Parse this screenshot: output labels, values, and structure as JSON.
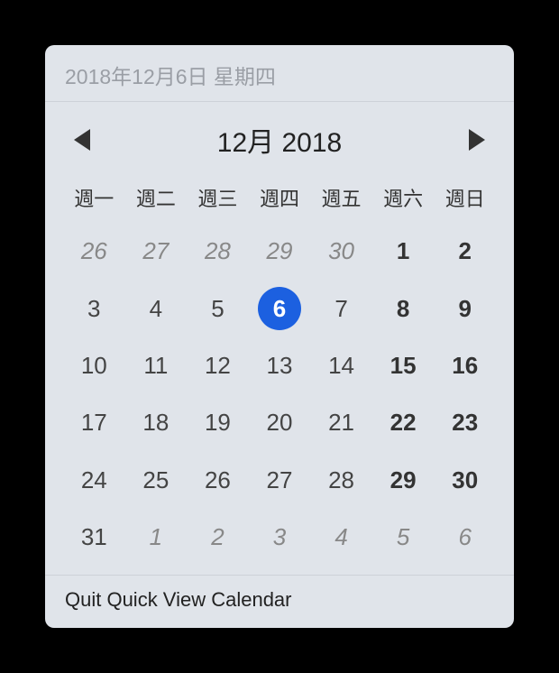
{
  "header": {
    "date_text": "2018年12月6日 星期四"
  },
  "nav": {
    "title": "12月 2018"
  },
  "days_of_week": [
    "週一",
    "週二",
    "週三",
    "週四",
    "週五",
    "週六",
    "週日"
  ],
  "weeks": [
    [
      {
        "n": "26",
        "other": true
      },
      {
        "n": "27",
        "other": true
      },
      {
        "n": "28",
        "other": true
      },
      {
        "n": "29",
        "other": true
      },
      {
        "n": "30",
        "other": true
      },
      {
        "n": "1",
        "weekend": true
      },
      {
        "n": "2",
        "weekend": true
      }
    ],
    [
      {
        "n": "3"
      },
      {
        "n": "4"
      },
      {
        "n": "5"
      },
      {
        "n": "6",
        "today": true
      },
      {
        "n": "7"
      },
      {
        "n": "8",
        "weekend": true
      },
      {
        "n": "9",
        "weekend": true
      }
    ],
    [
      {
        "n": "10"
      },
      {
        "n": "11"
      },
      {
        "n": "12"
      },
      {
        "n": "13"
      },
      {
        "n": "14"
      },
      {
        "n": "15",
        "weekend": true
      },
      {
        "n": "16",
        "weekend": true
      }
    ],
    [
      {
        "n": "17"
      },
      {
        "n": "18"
      },
      {
        "n": "19"
      },
      {
        "n": "20"
      },
      {
        "n": "21"
      },
      {
        "n": "22",
        "weekend": true
      },
      {
        "n": "23",
        "weekend": true
      }
    ],
    [
      {
        "n": "24"
      },
      {
        "n": "25"
      },
      {
        "n": "26"
      },
      {
        "n": "27"
      },
      {
        "n": "28"
      },
      {
        "n": "29",
        "weekend": true
      },
      {
        "n": "30",
        "weekend": true
      }
    ],
    [
      {
        "n": "31"
      },
      {
        "n": "1",
        "other": true
      },
      {
        "n": "2",
        "other": true
      },
      {
        "n": "3",
        "other": true
      },
      {
        "n": "4",
        "other": true
      },
      {
        "n": "5",
        "other": true
      },
      {
        "n": "6",
        "other": true
      }
    ]
  ],
  "footer": {
    "quit_label": "Quit Quick View Calendar"
  },
  "colors": {
    "accent": "#1C60E0"
  }
}
